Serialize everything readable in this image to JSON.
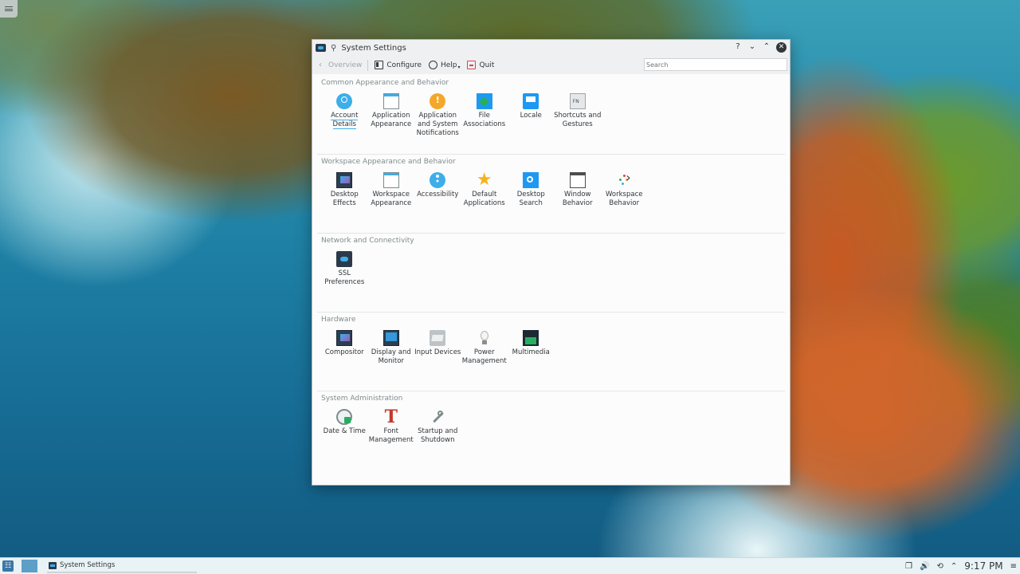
{
  "window": {
    "title": "System Settings",
    "pin_icon": "pin-icon",
    "controls": {
      "help": "?",
      "minimize": "⌄",
      "maximize": "⌃",
      "close": "✕"
    }
  },
  "toolbar": {
    "overview_label": "Overview",
    "configure_label": "Configure",
    "help_label": "Help",
    "quit_label": "Quit",
    "search_placeholder": "Search"
  },
  "sections": [
    {
      "title": "Common Appearance and Behavior",
      "items": [
        {
          "label": "Account Details",
          "icon": "account-icon"
        },
        {
          "label": "Application Appearance",
          "icon": "application-appearance-icon"
        },
        {
          "label": "Application and System Notifications",
          "icon": "notifications-icon"
        },
        {
          "label": "File Associations",
          "icon": "file-associations-icon"
        },
        {
          "label": "Locale",
          "icon": "locale-icon"
        },
        {
          "label": "Shortcuts and Gestures",
          "icon": "shortcuts-icon"
        }
      ]
    },
    {
      "title": "Workspace Appearance and Behavior",
      "items": [
        {
          "label": "Desktop Effects",
          "icon": "desktop-effects-icon"
        },
        {
          "label": "Workspace Appearance",
          "icon": "workspace-appearance-icon"
        },
        {
          "label": "Accessibility",
          "icon": "accessibility-icon"
        },
        {
          "label": "Default Applications",
          "icon": "star-icon"
        },
        {
          "label": "Desktop Search",
          "icon": "desktop-search-icon"
        },
        {
          "label": "Window Behavior",
          "icon": "window-behavior-icon"
        },
        {
          "label": "Workspace Behavior",
          "icon": "workspace-behavior-icon"
        }
      ]
    },
    {
      "title": "Network and Connectivity",
      "items": [
        {
          "label": "SSL Preferences",
          "icon": "ssl-icon"
        }
      ]
    },
    {
      "title": "Hardware",
      "items": [
        {
          "label": "Compositor",
          "icon": "compositor-icon"
        },
        {
          "label": "Display and Monitor",
          "icon": "monitor-icon"
        },
        {
          "label": "Input Devices",
          "icon": "input-devices-icon"
        },
        {
          "label": "Power Management",
          "icon": "power-bulb-icon"
        },
        {
          "label": "Multimedia",
          "icon": "multimedia-icon"
        }
      ]
    },
    {
      "title": "System Administration",
      "items": [
        {
          "label": "Date & Time",
          "icon": "clock-icon"
        },
        {
          "label": "Font Management",
          "icon": "font-icon"
        },
        {
          "label": "Startup and Shutdown",
          "icon": "tools-icon"
        }
      ]
    }
  ],
  "taskbar": {
    "task_label": "System Settings",
    "clock": "9:17 PM"
  },
  "colors": {
    "accent": "#3daee9",
    "window_bg": "#fcfcfc",
    "chrome_bg": "#eff0f1",
    "taskbar_bg": "#e9f2f4"
  }
}
